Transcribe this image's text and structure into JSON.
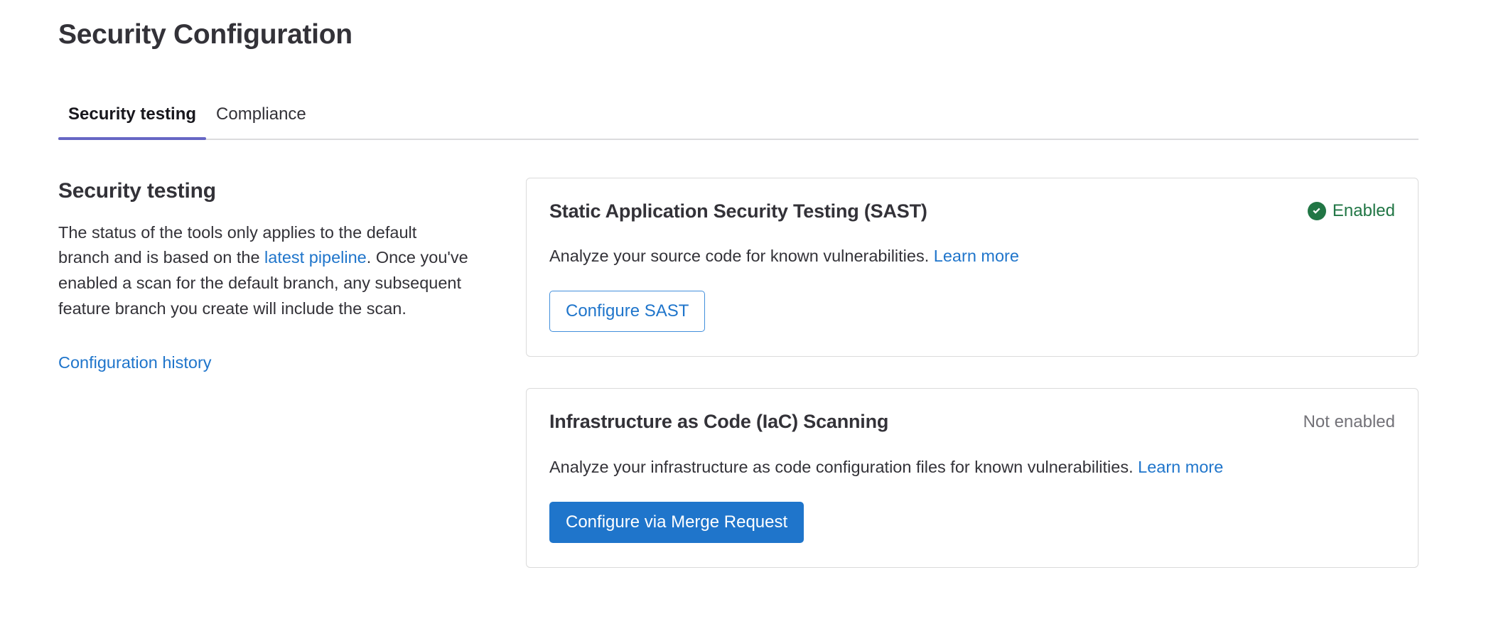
{
  "page": {
    "title": "Security Configuration"
  },
  "tabs": [
    {
      "label": "Security testing",
      "active": true
    },
    {
      "label": "Compliance",
      "active": false
    }
  ],
  "sidebar": {
    "heading": "Security testing",
    "description_part1": "The status of the tools only applies to the default branch and is based on the ",
    "description_link": "latest pipeline",
    "description_part2": ". Once you've enabled a scan for the default branch, any subsequent feature branch you create will include the scan.",
    "history_link": "Configuration history"
  },
  "cards": [
    {
      "title": "Static Application Security Testing (SAST)",
      "status_label": "Enabled",
      "status_state": "enabled",
      "status_icon": "check-circle-icon",
      "description": "Analyze your source code for known vulnerabilities. ",
      "description_link": "Learn more",
      "button_label": "Configure SAST",
      "button_style": "outline"
    },
    {
      "title": "Infrastructure as Code (IaC) Scanning",
      "status_label": "Not enabled",
      "status_state": "disabled",
      "status_icon": "",
      "description": "Analyze your infrastructure as code configuration files for known vulnerabilities. ",
      "description_link": "Learn more",
      "button_label": "Configure via Merge Request",
      "button_style": "primary"
    }
  ],
  "colors": {
    "link": "#1f75cb",
    "success": "#217645",
    "muted": "#737278",
    "tab_active_underline": "#6666c4",
    "card_border": "#dbdbdb",
    "primary_button": "#1f75cb",
    "text": "#333238"
  }
}
